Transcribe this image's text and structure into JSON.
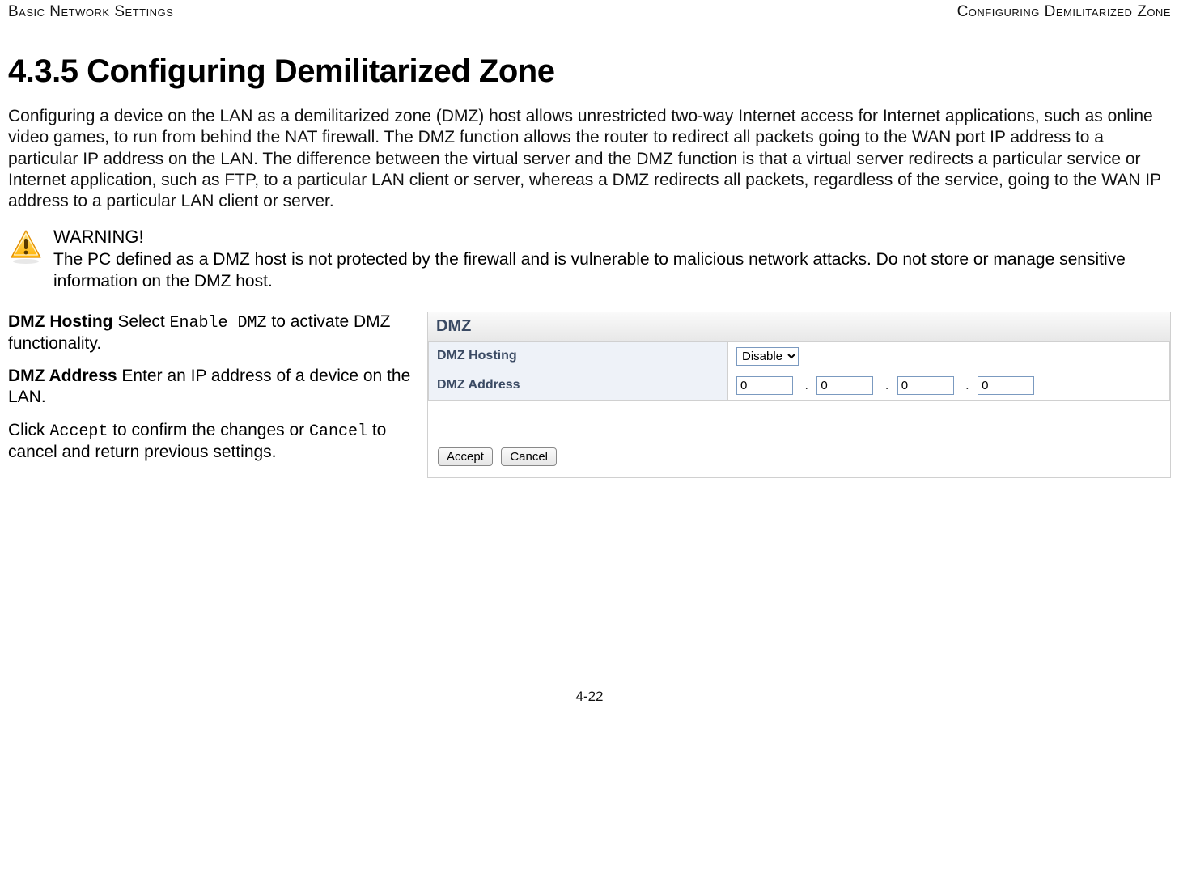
{
  "header": {
    "left": "Basic Network Settings",
    "right": "Configuring Demilitarized Zone"
  },
  "section": {
    "number": "4.3.5",
    "title": "Configuring Demilitarized Zone"
  },
  "intro": "Configuring a device on the LAN as a demilitarized zone (DMZ) host allows unrestricted two-way Internet access for Internet applications, such as online video games, to run from behind the NAT firewall. The DMZ function allows the router to redirect all packets going to the WAN port IP address to a particular IP address on the LAN. The difference between the virtual server and the DMZ function is that a virtual server redirects a particular service or Internet application, such as FTP, to a particular LAN client or server, whereas a DMZ redirects all packets, regardless of the service, going to the WAN IP address to a particular LAN client or server.",
  "warning": {
    "label": "WARNING!",
    "body": "The PC defined as a DMZ host is not protected by the firewall and is vulnerable to malicious network attacks. Do  not store or manage sensitive information on the DMZ host."
  },
  "definitions": {
    "hosting_label": "DMZ Hosting",
    "hosting_prefix": "  Select ",
    "hosting_code": "Enable DMZ",
    "hosting_suffix": " to activate DMZ functionality.",
    "address_label": "DMZ Address",
    "address_body": "  Enter an IP address of a device on the LAN.",
    "accept_prefix": "Click ",
    "accept_code": "Accept",
    "accept_mid": "  to confirm the changes or ",
    "cancel_code": "Cancel",
    "accept_suffix": " to cancel and return previous settings."
  },
  "panel": {
    "title": "DMZ",
    "rows": {
      "hosting_label": "DMZ Hosting",
      "hosting_value": "Disable",
      "address_label": "DMZ Address",
      "octets": [
        "0",
        "0",
        "0",
        "0"
      ]
    },
    "buttons": {
      "accept": "Accept",
      "cancel": "Cancel"
    }
  },
  "footer": "4-22"
}
